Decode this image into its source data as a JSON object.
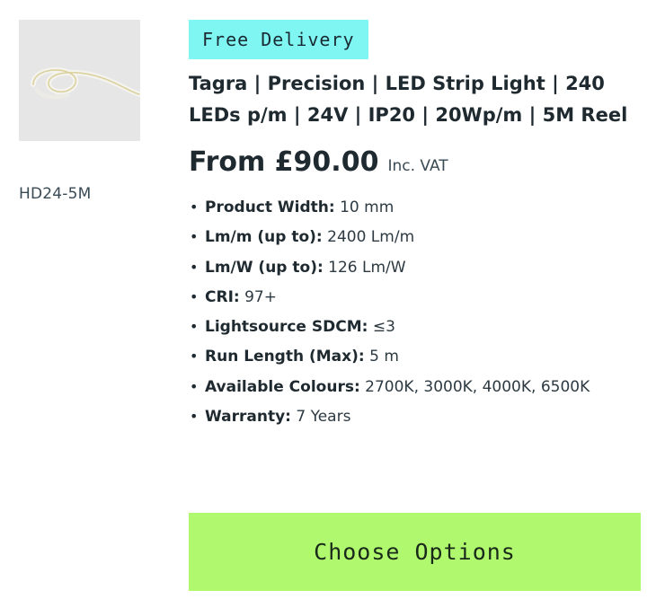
{
  "product": {
    "image_alt": "LED strip light reel",
    "sku": "HD24-5M",
    "badge": "Free Delivery",
    "title": "Tagra | Precision | LED Strip Light | 240 LEDs p/m | 24V | IP20 | 20Wp/m | 5M Reel",
    "price": "From £90.00",
    "vat_note": "Inc. VAT",
    "specs": [
      {
        "label": "Product Width:",
        "value": "10 mm"
      },
      {
        "label": "Lm/m (up to):",
        "value": "2400 Lm/m"
      },
      {
        "label": "Lm/W (up to):",
        "value": "126 Lm/W"
      },
      {
        "label": "CRI:",
        "value": "97+"
      },
      {
        "label": "Lightsource SDCM:",
        "value": "≤3"
      },
      {
        "label": "Run Length (Max):",
        "value": "5 m"
      },
      {
        "label": "Available Colours:",
        "value": "2700K, 3000K, 4000K, 6500K"
      },
      {
        "label": "Warranty:",
        "value": "7 Years"
      }
    ],
    "cta_label": "Choose Options"
  },
  "colors": {
    "badge_bg": "#7ff6f2",
    "cta_bg": "#b0f86e",
    "text": "#1f2a30"
  }
}
